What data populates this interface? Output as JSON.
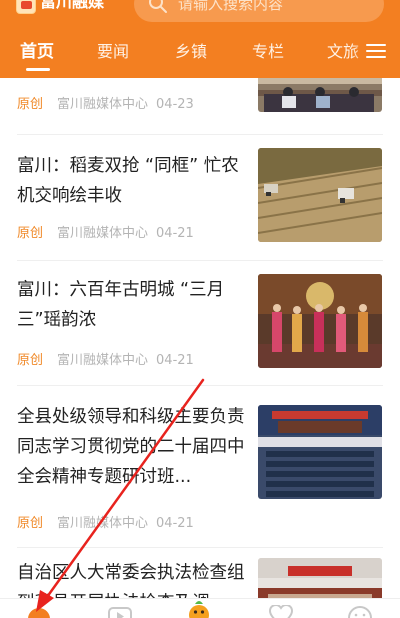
{
  "app": {
    "name": "富川融媒"
  },
  "search": {
    "placeholder": "请输入搜索内容"
  },
  "tabs": [
    {
      "label": "首页",
      "active": true
    },
    {
      "label": "要闻",
      "active": false
    },
    {
      "label": "乡镇",
      "active": false
    },
    {
      "label": "专栏",
      "active": false
    },
    {
      "label": "文旅",
      "active": false
    }
  ],
  "articles": [
    {
      "title": "",
      "tag": "原创",
      "source": "富川融媒体中心",
      "date": "04-23",
      "thumb": "meeting-room"
    },
    {
      "title": "富川：稻麦双抢 “同框” 忙农机交响绘丰收",
      "tag": "原创",
      "source": "富川融媒体中心",
      "date": "04-21",
      "thumb": "harvest-field"
    },
    {
      "title": "富川：六百年古明城 “三月三”瑶韵浓",
      "tag": "原创",
      "source": "富川融媒体中心",
      "date": "04-21",
      "thumb": "festival-performance"
    },
    {
      "title": "全县处级领导和科级主要负责同志学习贯彻党的二十届四中全会精神专题研讨班...",
      "tag": "原创",
      "source": "富川融媒体中心",
      "date": "04-21",
      "thumb": "auditorium-session"
    },
    {
      "title": "自治区人大常委会执法检查组到我县开展执法检查及调",
      "tag": "",
      "source": "",
      "date": "",
      "thumb": "meeting-hall"
    }
  ],
  "bottom_nav": [
    {
      "icon": "home-icon"
    },
    {
      "icon": "video-icon"
    },
    {
      "icon": "mascot-icon"
    },
    {
      "icon": "heart-icon"
    },
    {
      "icon": "smile-icon"
    }
  ],
  "colors": {
    "brand": "#f37f21",
    "tag": "#f08a2a",
    "meta": "#b4b4b4",
    "annotation": "#e8231e"
  }
}
